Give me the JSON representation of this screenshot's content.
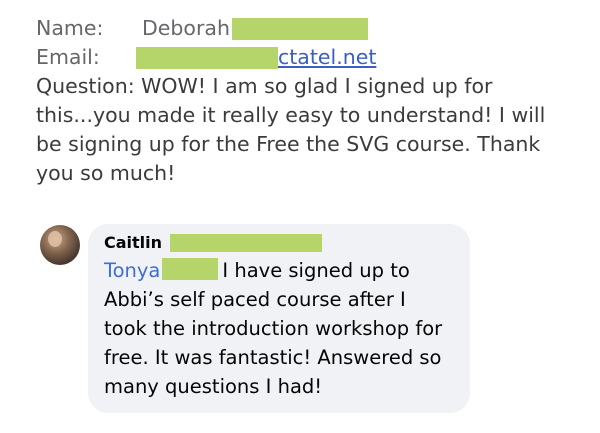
{
  "email": {
    "name_label": "Name:",
    "name_value": "Deborah",
    "email_label": "Email:",
    "email_domain": "ctatel.net",
    "question_text": "Question: WOW! I am so glad I signed up for this...you made it really easy to understand! I will be signing up for the Free the SVG course. Thank you so much!"
  },
  "comment": {
    "author": "Caitlin",
    "mention": "Tonya",
    "text": "I have signed up to Abbi’s self paced course after I took the introduction workshop for free. It was fantastic! Answered so many questions I had!"
  },
  "colors": {
    "redaction": "#b5d56a",
    "link": "#3b5fc0",
    "bubble_bg": "#f0f2f5"
  }
}
